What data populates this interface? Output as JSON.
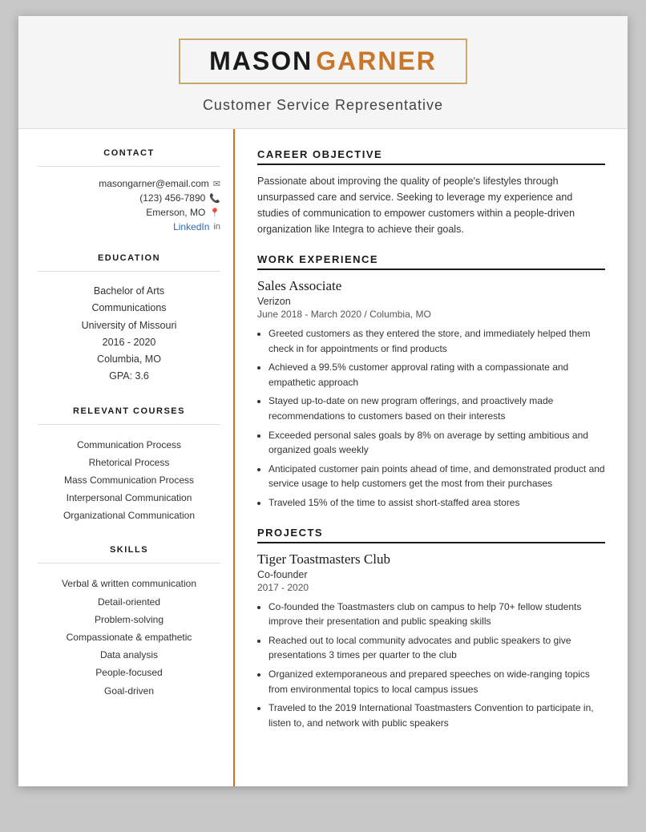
{
  "header": {
    "first_name": "MASON",
    "last_name": "GARNER",
    "title": "Customer Service Representative"
  },
  "sidebar": {
    "contact_heading": "CONTACT",
    "email": "masongarner@email.com",
    "phone": "(123) 456-7890",
    "location": "Emerson, MO",
    "linkedin_label": "LinkedIn",
    "education_heading": "EDUCATION",
    "degree": "Bachelor of Arts",
    "major": "Communications",
    "university": "University of Missouri",
    "years": "2016 - 2020",
    "city": "Columbia, MO",
    "gpa": "GPA: 3.6",
    "courses_heading": "RELEVANT COURSES",
    "courses": [
      "Communication Process",
      "Rhetorical Process",
      "Mass Communication Process",
      "Interpersonal Communication",
      "Organizational Communication"
    ],
    "skills_heading": "SKILLS",
    "skills": [
      "Verbal & written communication",
      "Detail-oriented",
      "Problem-solving",
      "Compassionate & empathetic",
      "Data analysis",
      "People-focused",
      "Goal-driven"
    ]
  },
  "main": {
    "career_objective_heading": "CAREER OBJECTIVE",
    "career_objective": "Passionate about improving the quality of people's lifestyles through unsurpassed care and service. Seeking to leverage my experience and studies of communication to empower customers within a people-driven organization like Integra to achieve their goals.",
    "work_experience_heading": "WORK EXPERIENCE",
    "job_title": "Sales Associate",
    "company": "Verizon",
    "job_meta": "June 2018 - March 2020  /  Columbia, MO",
    "job_bullets": [
      "Greeted customers as they entered the store, and immediately helped them check in for appointments or find products",
      "Achieved a 99.5% customer approval rating with a compassionate and empathetic approach",
      "Stayed up-to-date on new program offerings, and proactively made recommendations to customers based on their interests",
      "Exceeded personal sales goals by 8% on average by setting ambitious and organized goals weekly",
      "Anticipated customer pain points ahead of time, and demonstrated product and service usage to help customers get the most from their purchases",
      "Traveled 15% of the time to assist short-staffed area stores"
    ],
    "projects_heading": "PROJECTS",
    "project_title": "Tiger Toastmasters Club",
    "project_role": "Co-founder",
    "project_dates": "2017 - 2020",
    "project_bullets": [
      "Co-founded the Toastmasters club on campus to help 70+ fellow students improve their presentation and public speaking skills",
      "Reached out to local community advocates and public speakers to give presentations 3 times per quarter to the club",
      "Organized extemporaneous and prepared speeches on wide-ranging topics from environmental topics to local campus issues",
      "Traveled to the 2019 International Toastmasters Convention to participate in, listen to, and network with public speakers"
    ]
  }
}
